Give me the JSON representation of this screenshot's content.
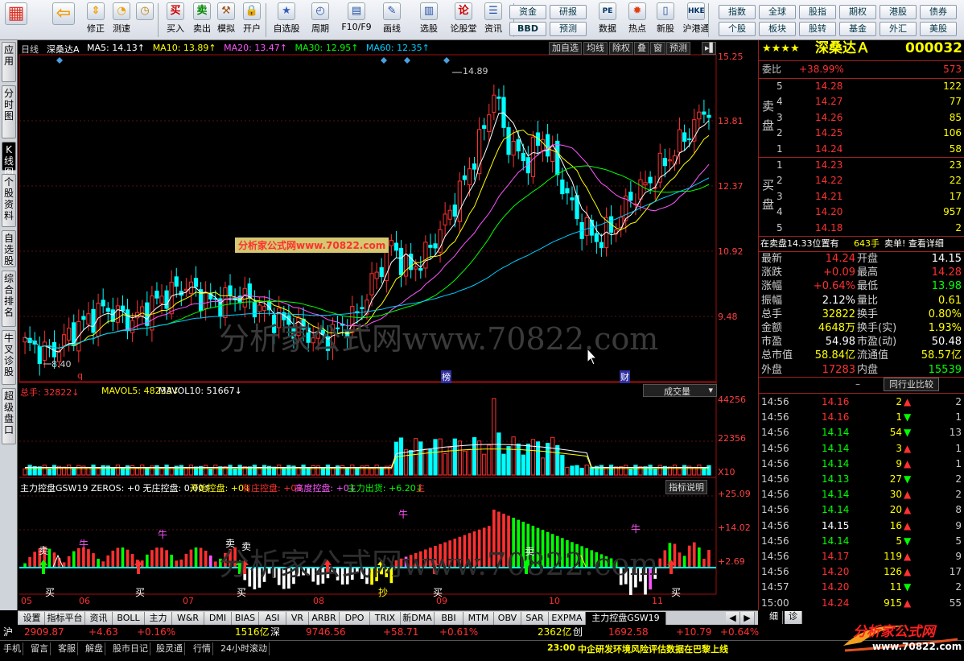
{
  "toolbar": {
    "buttons": [
      {
        "label": "",
        "icon": "grid-icon"
      },
      {
        "label": "",
        "icon": "back-arrow-icon"
      },
      {
        "label": "修正",
        "icon": "up-down-icon"
      },
      {
        "label": "测速",
        "icon": "speed-icon"
      },
      {
        "label": "",
        "icon": "clock-icon"
      },
      {
        "label": "买入",
        "icon": "buy-icon",
        "glyph": "买"
      },
      {
        "label": "卖出",
        "icon": "sell-icon",
        "glyph": "卖"
      },
      {
        "label": "模拟",
        "icon": "hammer-icon"
      },
      {
        "label": "开户",
        "icon": "lock-icon"
      },
      {
        "label": "自选股",
        "icon": "star-icon"
      },
      {
        "label": "周期",
        "icon": "period-icon"
      },
      {
        "label": "F10/F9",
        "icon": "f10-icon"
      },
      {
        "label": "画线",
        "icon": "pen-icon"
      },
      {
        "label": "选股",
        "icon": "select-icon"
      },
      {
        "label": "论股堂",
        "icon": "forum-icon",
        "glyph": "论"
      },
      {
        "label": "资讯",
        "icon": "info-icon"
      },
      {
        "label": "数据",
        "icon": "data-icon",
        "glyph": "PE"
      },
      {
        "label": "热点",
        "icon": "hot-icon"
      },
      {
        "label": "新股",
        "icon": "newstock-icon"
      },
      {
        "label": "沪港通",
        "icon": "hk-icon",
        "glyph": "HKE"
      }
    ],
    "pills_a": [
      "资金",
      "研报",
      "BBD",
      "预测"
    ],
    "pills_b": [
      "指数",
      "全球",
      "股指",
      "期权",
      "港股",
      "债券",
      "个股",
      "板块",
      "股转",
      "基金",
      "外汇",
      "美股"
    ]
  },
  "left_tabs": [
    "应用",
    "分时图",
    "K线图",
    "个股资料",
    "自选股",
    "综合排名",
    "牛叉诊股",
    "超级盘口"
  ],
  "chart": {
    "title": "日线",
    "stock": "深桑达A",
    "ma": [
      {
        "label": "MA5: 14.13↑",
        "color": "#ffffff"
      },
      {
        "label": "MA10: 13.89↑",
        "color": "#ffff00"
      },
      {
        "label": "MA20: 13.47↑",
        "color": "#ff55ff"
      },
      {
        "label": "MA30: 12.95↑",
        "color": "#00ff00"
      },
      {
        "label": "MA60: 12.35↑",
        "color": "#00ccff"
      }
    ],
    "tools": [
      "加自选",
      "均线",
      "除权",
      "叠",
      "窗",
      "预测"
    ],
    "y_prices": [
      "15.25",
      "13.81",
      "12.37",
      "10.92",
      "9.48"
    ],
    "high_label": "14.89",
    "low_label": "8.40",
    "marks": [
      "q",
      "榜",
      "财"
    ],
    "watermark": "分析家公式网www.70822.com",
    "watermark_box": "分析家公式网www.70822.com",
    "vol": {
      "header": [
        "总手: 32822↓",
        "MAVOL5: 48233↓",
        "MAVOL10: 51667↓"
      ],
      "dropdown": "成交量",
      "y": [
        "44256",
        "22356",
        "X10"
      ]
    },
    "ind": {
      "header": [
        {
          "text": "主力控盘GSW19 ZEROS: +0 无庄控盘: 0.00↑",
          "color": "#ffffff"
        },
        {
          "text": "开始控盘: +0↓",
          "color": "#ffff00"
        },
        {
          "text": "有庄控盘: +0↓",
          "color": "#ff3030"
        },
        {
          "text": "高度控盘: +0↓",
          "color": "#ff55ff"
        },
        {
          "text": "主力出货: +6.20↓",
          "color": "#00ff00"
        },
        {
          "text": "主",
          "color": "#ff3030"
        }
      ],
      "btn": "指标说明",
      "y": [
        "+25.09",
        "+14.02",
        "+2.69"
      ],
      "signals": [
        "卖",
        "牛",
        "牛",
        "卖",
        "卖",
        "牛",
        "卖",
        "牛",
        "买",
        "买",
        "买",
        "抄",
        "买",
        "买"
      ]
    },
    "months": [
      "05",
      "06",
      "07",
      "08",
      "09",
      "10",
      "11"
    ]
  },
  "right": {
    "stars": "★★★★",
    "name": "深桑达Ａ",
    "code": "000032",
    "weibi_label": "委比",
    "weibi": "+38.99%",
    "weibi_num": "573",
    "sell_label": "卖盘",
    "buy_label": "买盘",
    "asks": [
      {
        "n": "5",
        "p": "14.28",
        "v": "122"
      },
      {
        "n": "4",
        "p": "14.27",
        "v": "77"
      },
      {
        "n": "3",
        "p": "14.26",
        "v": "85"
      },
      {
        "n": "2",
        "p": "14.25",
        "v": "106"
      },
      {
        "n": "1",
        "p": "14.24",
        "v": "58"
      }
    ],
    "bids": [
      {
        "n": "1",
        "p": "14.23",
        "v": "23"
      },
      {
        "n": "2",
        "p": "14.22",
        "v": "22"
      },
      {
        "n": "3",
        "p": "14.21",
        "v": "17"
      },
      {
        "n": "4",
        "p": "14.20",
        "v": "957"
      },
      {
        "n": "5",
        "p": "14.18",
        "v": "2"
      }
    ],
    "notice": {
      "a": "在卖盘14.33位置有",
      "b": "643手",
      "c": "卖单! 查看详细"
    },
    "stats": [
      {
        "l1": "最新",
        "v1": "14.24",
        "c1": "#ff3030",
        "l2": "开盘",
        "v2": "14.15",
        "c2": "#ffffff"
      },
      {
        "l1": "涨跌",
        "v1": "+0.09",
        "c1": "#ff3030",
        "l2": "最高",
        "v2": "14.28",
        "c2": "#ff3030"
      },
      {
        "l1": "涨幅",
        "v1": "+0.64%",
        "c1": "#ff3030",
        "l2": "最低",
        "v2": "13.98",
        "c2": "#00ff00"
      },
      {
        "l1": "振幅",
        "v1": "2.12%",
        "c1": "#ffffff",
        "l2": "量比",
        "v2": "0.61",
        "c2": "#ffff00"
      },
      {
        "l1": "总手",
        "v1": "32822",
        "c1": "#ffff00",
        "l2": "换手",
        "v2": "0.80%",
        "c2": "#ffff00"
      },
      {
        "l1": "金额",
        "v1": "4648万",
        "c1": "#ffff00",
        "l2": "换手(实)",
        "v2": "1.93%",
        "c2": "#ffff00"
      },
      {
        "l1": "市盈",
        "v1": "54.98",
        "c1": "#ffffff",
        "l2": "市盈(动)",
        "v2": "50.48",
        "c2": "#ffffff"
      },
      {
        "l1": "总市值",
        "v1": "58.84亿",
        "c1": "#ffff00",
        "l2": "流通值",
        "v2": "58.57亿",
        "c2": "#ffff00"
      },
      {
        "l1": "外盘",
        "v1": "17283",
        "c1": "#ff3030",
        "l2": "内盘",
        "v2": "15539",
        "c2": "#00ff00"
      }
    ],
    "compare_btn": "同行业比较",
    "ticks": [
      {
        "t": "14:56",
        "p": "14.16",
        "pc": "#ff3030",
        "v": "2",
        "d": "up",
        "n": "2"
      },
      {
        "t": "14:56",
        "p": "14.16",
        "pc": "#ff3030",
        "v": "1",
        "d": "down",
        "n": "1"
      },
      {
        "t": "14:56",
        "p": "14.14",
        "pc": "#00ff00",
        "v": "54",
        "d": "down",
        "n": "13"
      },
      {
        "t": "14:56",
        "p": "14.14",
        "pc": "#00ff00",
        "v": "3",
        "d": "up",
        "n": "1"
      },
      {
        "t": "14:56",
        "p": "14.14",
        "pc": "#00ff00",
        "v": "9",
        "d": "up",
        "n": "1"
      },
      {
        "t": "14:56",
        "p": "14.13",
        "pc": "#00ff00",
        "v": "27",
        "d": "down",
        "n": "2"
      },
      {
        "t": "14:56",
        "p": "14.14",
        "pc": "#00ff00",
        "v": "30",
        "d": "up",
        "n": "2"
      },
      {
        "t": "14:56",
        "p": "14.14",
        "pc": "#00ff00",
        "v": "20",
        "d": "up",
        "n": "8"
      },
      {
        "t": "14:56",
        "p": "14.15",
        "pc": "#ffffff",
        "v": "16",
        "d": "up",
        "n": "9"
      },
      {
        "t": "14:56",
        "p": "14.14",
        "pc": "#00ff00",
        "v": "5",
        "d": "down",
        "n": "5"
      },
      {
        "t": "14:56",
        "p": "14.17",
        "pc": "#ff3030",
        "v": "119",
        "d": "up",
        "n": "9"
      },
      {
        "t": "14:56",
        "p": "14.20",
        "pc": "#ff3030",
        "v": "126",
        "d": "up",
        "n": "17"
      },
      {
        "t": "14:57",
        "p": "14.20",
        "pc": "#ff3030",
        "v": "11",
        "d": "down",
        "n": "2"
      },
      {
        "t": "15:00",
        "p": "14.24",
        "pc": "#ff3030",
        "v": "915",
        "d": "up",
        "n": "55"
      }
    ],
    "bottom_tabs": [
      "细",
      "诊"
    ]
  },
  "bottom_tabs": [
    "设置",
    "指标平台",
    "资讯",
    "BOLL",
    "主力",
    "W&R",
    "DMI",
    "BIAS",
    "ASI",
    "VR",
    "ARBR",
    "DPO",
    "TRIX",
    "新DMA",
    "BBI",
    "MTM",
    "OBV",
    "SAR",
    "EXPMA",
    "主力控盘GSW19"
  ],
  "index_bar": {
    "sh_label": "沪",
    "sh_val": "2909.87",
    "sh_chg": "+4.63",
    "sh_pct": "+0.16%",
    "sh_amt": "1516亿",
    "sz_label": "深",
    "sz_val": "9746.56",
    "sz_chg": "+58.71",
    "sz_pct": "+0.61%",
    "sz_amt": "2362亿",
    "cy_label": "创",
    "cy_val": "1692.58",
    "cy_chg": "+10.79",
    "cy_pct": "+0.64%"
  },
  "status": {
    "items": [
      "手机",
      "留言",
      "客服",
      "解盘",
      "股市日记",
      "股灵通",
      "行情",
      "24小时滚动"
    ],
    "news_time": "23:00",
    "news": "中企研发环境风险评估数据在巴黎上线"
  },
  "logo": {
    "text": "分析家公式网",
    "url": "www.70822.com"
  },
  "colors": {
    "up": "#ff3030",
    "down": "#00ffff",
    "accent": "#ffff00"
  }
}
